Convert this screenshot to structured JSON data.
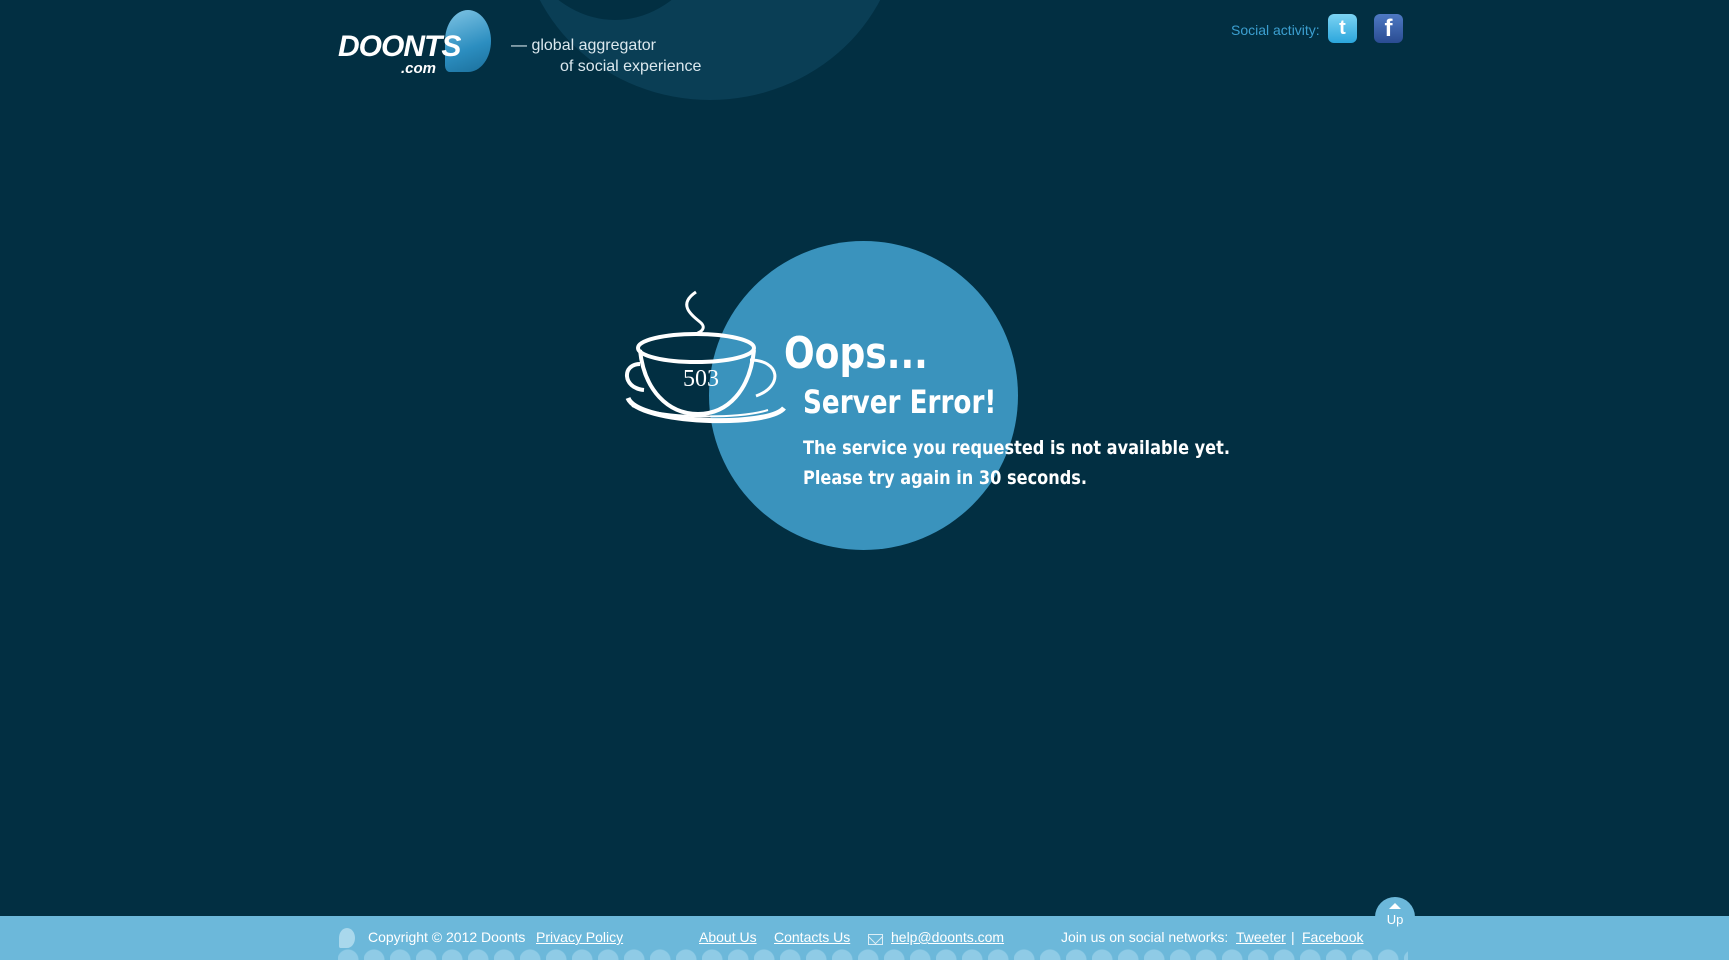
{
  "header": {
    "logo_text": "DOONTS",
    "logo_domain": ".com",
    "tagline_line1": "— global aggregator",
    "tagline_line2": "of social experience",
    "social_label": "Social activity:",
    "social_icons": [
      "twitter-icon",
      "facebook-icon"
    ]
  },
  "error": {
    "code": "503",
    "title": "Oops...",
    "subtitle": "Server Error!",
    "message_line1": "The service you requested is not available yet.",
    "message_line2": "Please try again in 30 seconds."
  },
  "footer": {
    "copyright": "Copyright © 2012 Doonts",
    "privacy": "Privacy Policy",
    "about": "About Us",
    "contacts": "Contacts Us",
    "email": "help@doonts.com",
    "join_label": "Join us on social networks:",
    "tweeter": "Tweeter",
    "separator": "|",
    "facebook": "Facebook",
    "up_label": "Up"
  },
  "colors": {
    "background": "#022f42",
    "circle": "#3a93bd",
    "footer": "#6cb8da",
    "accent": "#3c9fd0"
  }
}
